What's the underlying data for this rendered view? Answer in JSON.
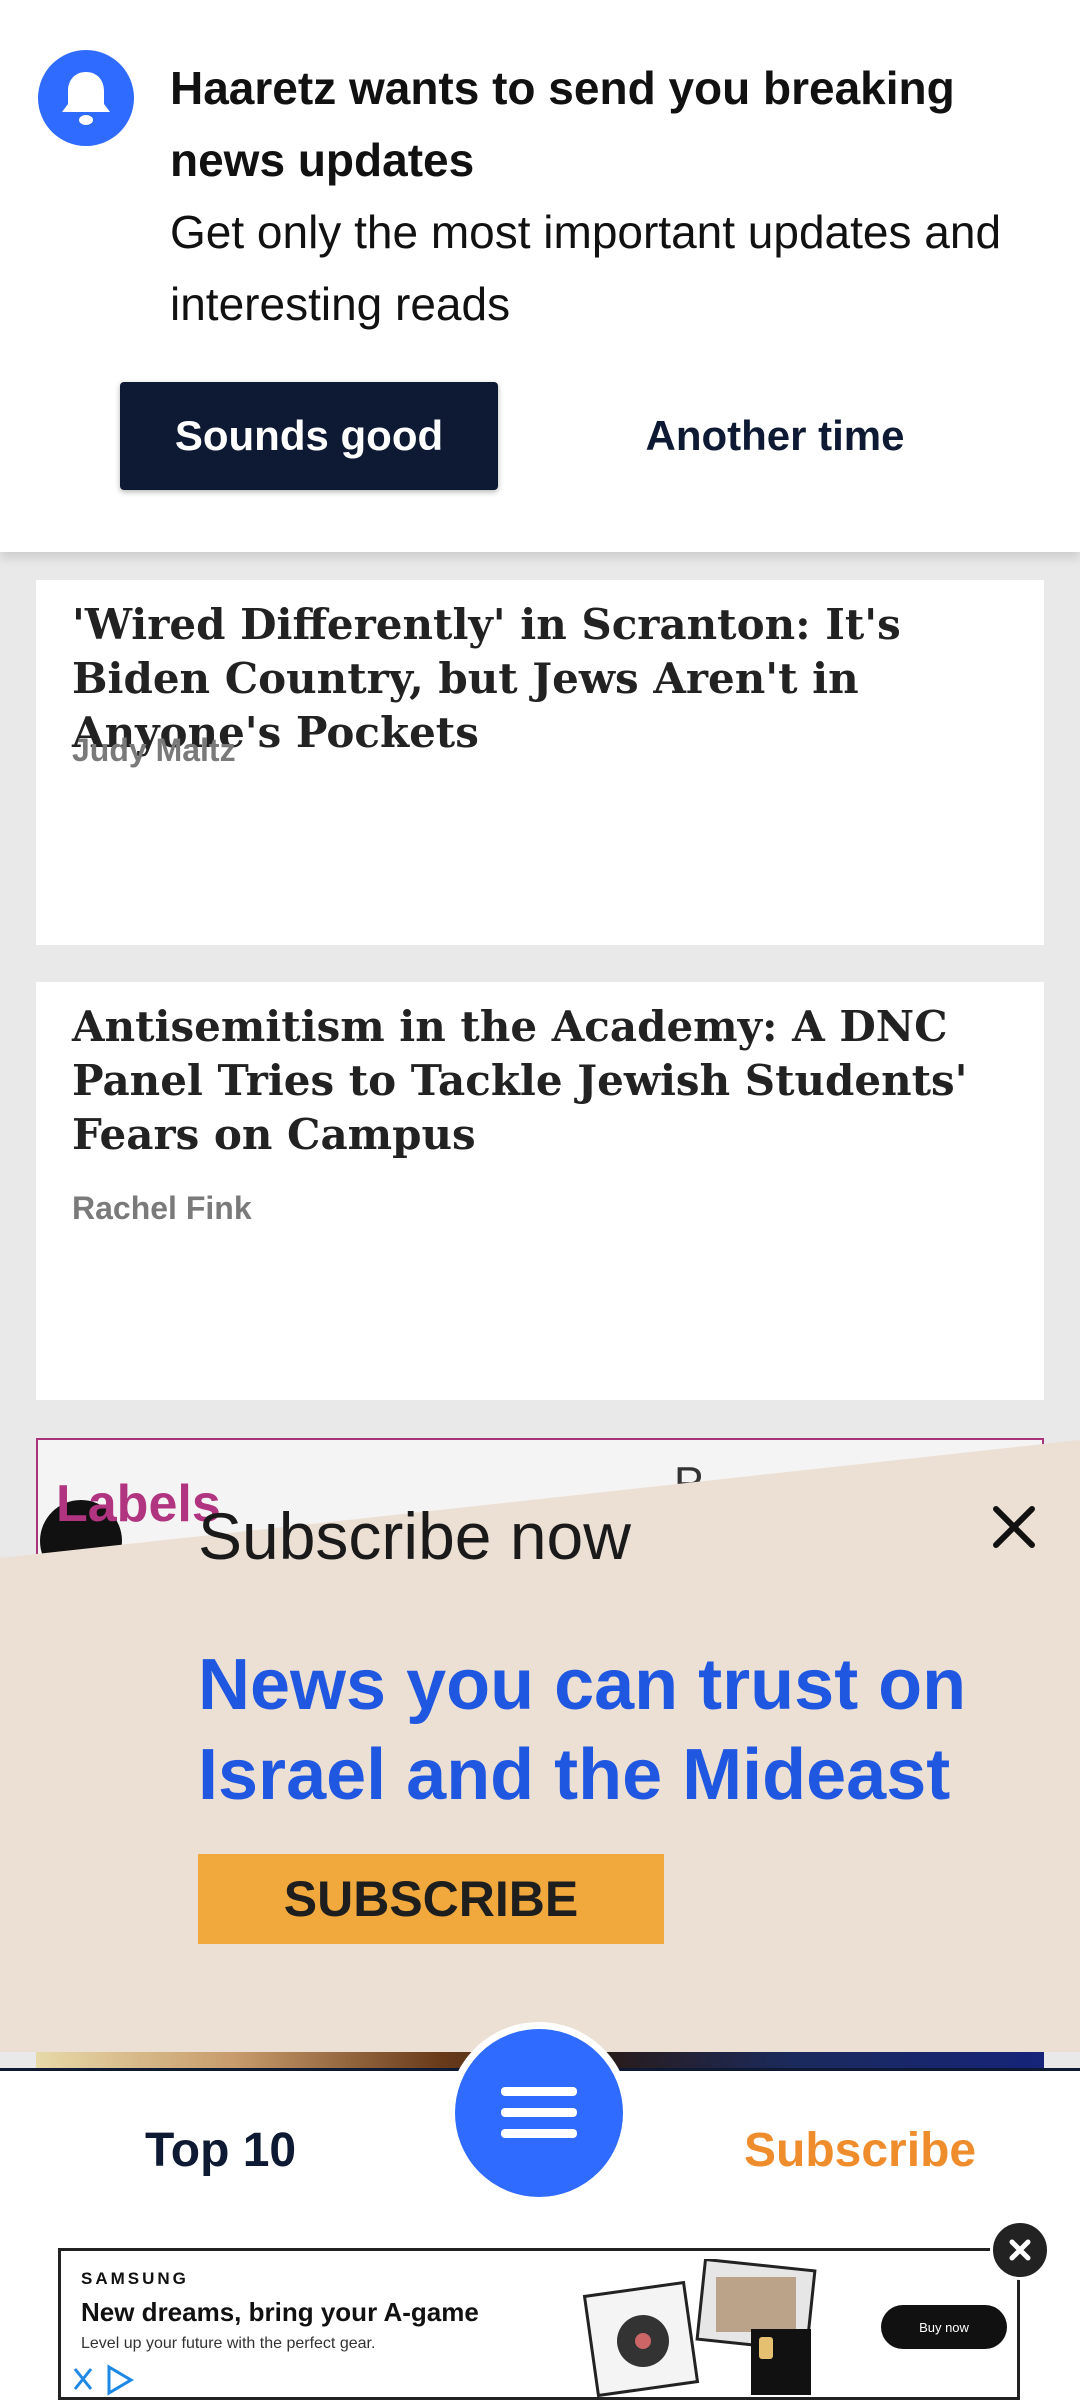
{
  "notification": {
    "title": "Haaretz wants to send you breaking news updates",
    "body": "Get only the most important updates and interesting reads",
    "accept_label": "Sounds good",
    "decline_label": "Another time",
    "icon": "bell-icon"
  },
  "articles": [
    {
      "title": "'Wired Differently' in Scranton: It's Biden Country, but Jews Aren't in Anyone's Pockets",
      "author": "Judy Maltz"
    },
    {
      "title": "Antisemitism in the Academy: A DNC Panel Tries to Tackle Jewish Students' Fears on Campus",
      "author": "Rachel Fink"
    }
  ],
  "labels_card": {
    "label": "Labels",
    "partial_letter": "P"
  },
  "subscribe_popup": {
    "title": "Subscribe now",
    "headline": "News you can trust on Israel and the Mideast",
    "button_label": "SUBSCRIBE",
    "close_icon": "close-icon"
  },
  "bottom_nav": {
    "left_label": "Top 10",
    "right_label": "Subscribe",
    "menu_icon": "hamburger-menu-icon"
  },
  "ad": {
    "brand": "SAMSUNG",
    "headline": "New dreams, bring your A-game",
    "subtext": "Level up your future with the perfect gear.",
    "cta": "Buy now"
  },
  "colors": {
    "accent_blue": "#2f6bff",
    "navy": "#0e1a33",
    "subscribe_orange": "#ef8d2d",
    "labels_magenta": "#b0347f",
    "popup_bg": "#ece0d4",
    "headline_blue": "#2057e0",
    "button_yellow": "#f1a83c"
  }
}
